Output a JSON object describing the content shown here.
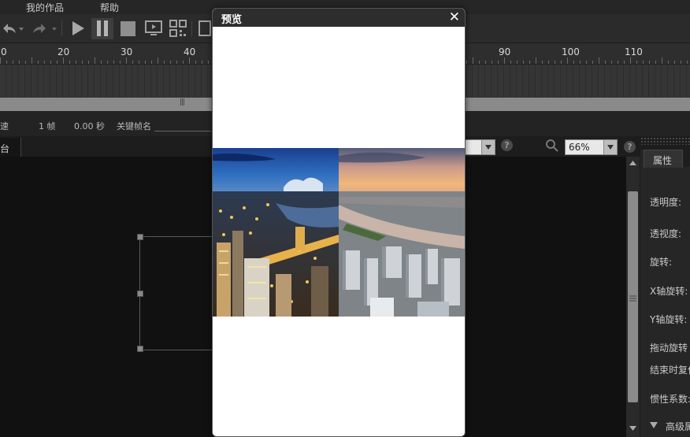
{
  "menu": {
    "items": [
      "我的作品",
      "帮助"
    ]
  },
  "toolbar": {
    "icons": [
      "undo-icon",
      "redo-icon",
      "play-icon",
      "pause-icon",
      "stop-icon",
      "preview-screen-icon",
      "qrcode-icon"
    ]
  },
  "ruler": {
    "ticks": [
      "0",
      "20",
      "30",
      "40",
      "90",
      "100",
      "110"
    ]
  },
  "framebar": {
    "speed_label": "速",
    "frame_count": "1 帧",
    "time": "0.00 秒",
    "keyframe_label": "关键帧名"
  },
  "tabs": {
    "stage": "台"
  },
  "canvas_toolbar": {
    "zoom": "66%"
  },
  "properties": {
    "tab": "属性",
    "labels": [
      "透明度:",
      "透视度:",
      "旋转:",
      "X轴旋转:",
      "Y轴旋转:",
      "拖动旋转",
      "结束时复位",
      "惯性系数:",
      "高级属性"
    ]
  },
  "modal": {
    "title": "预览",
    "close": "✕",
    "left_image": "night city skyline with river",
    "right_image": "sunset city skyline with river"
  },
  "colors": {
    "modal_header": "#2d2d2d",
    "canvas": "#111111",
    "panel": "#262626"
  }
}
